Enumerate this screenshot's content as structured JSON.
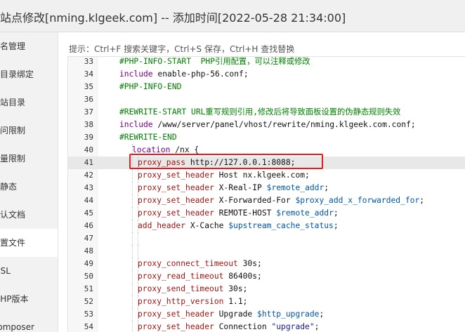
{
  "window": {
    "title": "站点修改[nming.klgeek.com] -- 添加时间[2022-05-28 21:34:00]"
  },
  "sidebar": {
    "items": [
      {
        "label": "域名管理"
      },
      {
        "label": "子目录绑定"
      },
      {
        "label": "网站目录"
      },
      {
        "label": "访问限制"
      },
      {
        "label": "流量限制"
      },
      {
        "label": "伪静态"
      },
      {
        "label": "默认文档"
      },
      {
        "label": "配置文件",
        "active": true
      },
      {
        "label": "SSL"
      },
      {
        "label": "PHP版本"
      },
      {
        "label": "Composer"
      }
    ]
  },
  "hint": "提示：Ctrl+F 搜索关键字，Ctrl+S 保存，Ctrl+H 查找替换",
  "editor": {
    "lines": [
      {
        "n": "33",
        "indent": 0,
        "tokens": [
          {
            "t": "#PHP-INFO-START  PHP引用配置，可以注释或修改",
            "c": "c-comment"
          }
        ]
      },
      {
        "n": "34",
        "indent": 0,
        "tokens": [
          {
            "t": "include",
            "c": "c-kw"
          },
          {
            "t": " enable-php-56.conf;",
            "c": "c-text"
          }
        ]
      },
      {
        "n": "35",
        "indent": 0,
        "tokens": [
          {
            "t": "#PHP-INFO-END",
            "c": "c-comment"
          }
        ]
      },
      {
        "n": "36",
        "indent": 0,
        "tokens": []
      },
      {
        "n": "37",
        "indent": 0,
        "tokens": [
          {
            "t": "#REWRITE-START URL重写规则引用,修改后将导致面板设置的伪静态规则失效",
            "c": "c-comment"
          }
        ]
      },
      {
        "n": "38",
        "indent": 0,
        "tokens": [
          {
            "t": "include",
            "c": "c-kw"
          },
          {
            "t": " /www/server/panel/vhost/rewrite/nming.klgeek.com.conf;",
            "c": "c-text"
          }
        ]
      },
      {
        "n": "39",
        "indent": 0,
        "tokens": [
          {
            "t": "#REWRITE-END",
            "c": "c-comment"
          }
        ]
      },
      {
        "n": "40",
        "indent": 1,
        "tokens": [
          {
            "t": "location",
            "c": "c-kw"
          },
          {
            "t": " /nx {",
            "c": "c-text"
          }
        ]
      },
      {
        "n": "41",
        "indent": 2,
        "active": true,
        "tokens": [
          {
            "t": "proxy_pass",
            "c": "c-dir"
          },
          {
            "t": " http://127.0.0.1:8088;",
            "c": "c-text"
          }
        ]
      },
      {
        "n": "42",
        "indent": 2,
        "tokens": [
          {
            "t": "proxy_set_header",
            "c": "c-dir"
          },
          {
            "t": " Host nx.klgeek.com;",
            "c": "c-text"
          }
        ]
      },
      {
        "n": "43",
        "indent": 2,
        "tokens": [
          {
            "t": "proxy_set_header",
            "c": "c-dir"
          },
          {
            "t": " X-Real-IP ",
            "c": "c-text"
          },
          {
            "t": "$remote_addr",
            "c": "c-var"
          },
          {
            "t": ";",
            "c": "c-text"
          }
        ]
      },
      {
        "n": "44",
        "indent": 2,
        "tokens": [
          {
            "t": "proxy_set_header",
            "c": "c-dir"
          },
          {
            "t": " X-Forwarded-For ",
            "c": "c-text"
          },
          {
            "t": "$proxy_add_x_forwarded_for",
            "c": "c-var"
          },
          {
            "t": ";",
            "c": "c-text"
          }
        ]
      },
      {
        "n": "45",
        "indent": 2,
        "tokens": [
          {
            "t": "proxy_set_header",
            "c": "c-dir"
          },
          {
            "t": " REMOTE-HOST ",
            "c": "c-text"
          },
          {
            "t": "$remote_addr",
            "c": "c-var"
          },
          {
            "t": ";",
            "c": "c-text"
          }
        ]
      },
      {
        "n": "46",
        "indent": 2,
        "tokens": [
          {
            "t": "add_header",
            "c": "c-dir"
          },
          {
            "t": " X-Cache ",
            "c": "c-text"
          },
          {
            "t": "$upstream_cache_status",
            "c": "c-var"
          },
          {
            "t": ";",
            "c": "c-text"
          }
        ]
      },
      {
        "n": "47",
        "indent": 2,
        "tokens": []
      },
      {
        "n": "48",
        "indent": 2,
        "tokens": []
      },
      {
        "n": "49",
        "indent": 2,
        "tokens": [
          {
            "t": "proxy_connect_timeout",
            "c": "c-dir"
          },
          {
            "t": " 30s;",
            "c": "c-text"
          }
        ]
      },
      {
        "n": "50",
        "indent": 2,
        "tokens": [
          {
            "t": "proxy_read_timeout",
            "c": "c-dir"
          },
          {
            "t": " 86400s;",
            "c": "c-text"
          }
        ]
      },
      {
        "n": "51",
        "indent": 2,
        "tokens": [
          {
            "t": "proxy_send_timeout",
            "c": "c-dir"
          },
          {
            "t": " 30s;",
            "c": "c-text"
          }
        ]
      },
      {
        "n": "52",
        "indent": 2,
        "tokens": [
          {
            "t": "proxy_http_version",
            "c": "c-dir"
          },
          {
            "t": " 1.1;",
            "c": "c-text"
          }
        ]
      },
      {
        "n": "53",
        "indent": 2,
        "tokens": [
          {
            "t": "proxy_set_header",
            "c": "c-dir"
          },
          {
            "t": " Upgrade ",
            "c": "c-text"
          },
          {
            "t": "$http_upgrade",
            "c": "c-var"
          },
          {
            "t": ";",
            "c": "c-text"
          }
        ]
      },
      {
        "n": "54",
        "indent": 2,
        "tokens": [
          {
            "t": "proxy_set_header",
            "c": "c-dir"
          },
          {
            "t": " Connection ",
            "c": "c-text"
          },
          {
            "t": "\"upgrade\"",
            "c": "c-str"
          },
          {
            "t": ";",
            "c": "c-text"
          }
        ]
      }
    ]
  }
}
